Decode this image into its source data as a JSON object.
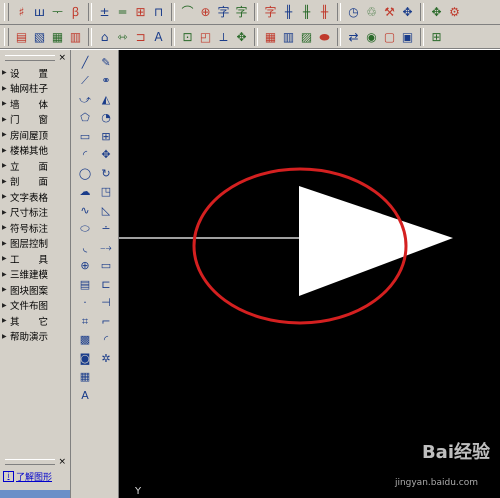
{
  "toolbar_top": {
    "icons": [
      "grid-hash-icon",
      "column-grid-icon",
      "axis-icon",
      "dim-icon",
      "wall-icon",
      "beam-icon",
      "window-icon",
      "door-icon",
      "arc-door-icon",
      "component-icon",
      "char-icon",
      "char-icon",
      "char-icon",
      "rail-icon",
      "rail-icon",
      "rail-icon",
      "clock-icon",
      "recycle-icon",
      "tools-icon",
      "move-cross-icon",
      "copy-icon",
      "gear-icon"
    ],
    "glyphs": [
      "♯",
      "ꟺ",
      "ᅮ",
      "ꞵ",
      "±",
      "═",
      "⊞",
      "⊓",
      "⌒",
      "⊕",
      "字",
      "字",
      "字",
      "╫",
      "╫",
      "╫",
      "◷",
      "♲",
      "⚒",
      "✥",
      "✥",
      "⚙"
    ]
  },
  "toolbar_second": {
    "icons": [
      "new-icon",
      "open-icon",
      "layer-icon",
      "print-icon",
      "floor-icon",
      "stair-icon",
      "door-icon",
      "text-a-icon",
      "paste-icon",
      "zoom-icon",
      "measure-icon",
      "pan-icon",
      "grid-icon",
      "table-icon",
      "chart-icon",
      "car-icon",
      "undo-icon",
      "eye-icon",
      "window-icon",
      "frame-icon",
      "ruler-icon"
    ],
    "glyphs": [
      "▤",
      "▧",
      "▦",
      "▥",
      "⌂",
      "⇿",
      "⊐",
      "A",
      "⊡",
      "◰",
      "⟂",
      "✥",
      "▦",
      "▥",
      "▨",
      "⬬",
      "⇄",
      "◉",
      "▢",
      "▣",
      "⊞"
    ]
  },
  "side_panel": {
    "close": "×",
    "items": [
      "设　　置",
      "轴网柱子",
      "墙　　体",
      "门　　窗",
      "房间屋顶",
      "楼梯其他",
      "立　　面",
      "剖　　面",
      "文字表格",
      "尺寸标注",
      "符号标注",
      "图层控制",
      "工　　具",
      "三维建模",
      "图块图案",
      "文件布图",
      "其　　它",
      "帮助演示"
    ],
    "help_link": "了解图形"
  },
  "draw_toolbar": {
    "left": [
      "line-icon",
      "polyline-icon",
      "arc-icon",
      "polygon-icon",
      "rectangle-icon",
      "arc-icon",
      "circle-icon",
      "cloud-icon",
      "spline-icon",
      "ellipse-icon",
      "ellipse-arc-icon",
      "insert-icon",
      "block-icon",
      "point-icon",
      "hatch-icon",
      "gradient-icon",
      "region-icon",
      "table-icon",
      "text-icon"
    ],
    "left_glyphs": [
      "╱",
      "⟋",
      "⤻",
      "⬠",
      "▭",
      "◜",
      "◯",
      "☁",
      "∿",
      "⬭",
      "◟",
      "⊕",
      "▤",
      "·",
      "⌗",
      "▩",
      "◙",
      "▦",
      "A"
    ],
    "right": [
      "erase-icon",
      "copy-icon",
      "mirror-icon",
      "offset-icon",
      "array-icon",
      "move-icon",
      "rotate-icon",
      "scale-icon",
      "stretch-icon",
      "trim-icon",
      "extend-icon",
      "break-icon",
      "break-point-icon",
      "join-icon",
      "chamfer-icon",
      "fillet-icon",
      "explode-icon"
    ],
    "right_glyphs": [
      "✎",
      "⚭",
      "◭",
      "◔",
      "⊞",
      "✥",
      "↻",
      "◳",
      "◺",
      "∸",
      "⤍",
      "▭",
      "⊏",
      "⊣",
      "⌐",
      "◜",
      "✲"
    ]
  },
  "canvas": {
    "background": "#000000",
    "ellipse_color": "#d42020",
    "triangle_color": "#ffffff",
    "line_color": "#ffffff",
    "ucs_label": "Y"
  },
  "watermark": {
    "brand": "Bai经验",
    "url": "jingyan.baidu.com"
  }
}
